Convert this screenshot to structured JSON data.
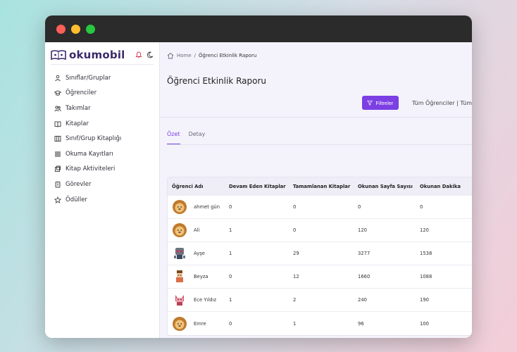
{
  "brand": {
    "name": "okumobil"
  },
  "sidebar": {
    "items": [
      {
        "label": "Sınıflar/Gruplar",
        "icon": "classes-icon"
      },
      {
        "label": "Öğrenciler",
        "icon": "graduation-cap-icon"
      },
      {
        "label": "Takımlar",
        "icon": "users-icon"
      },
      {
        "label": "Kitaplar",
        "icon": "open-book-icon"
      },
      {
        "label": "Sınıf/Grup Kitaplığı",
        "icon": "library-icon"
      },
      {
        "label": "Okuma Kayıtları",
        "icon": "list-icon"
      },
      {
        "label": "Kitap Aktiviteleri",
        "icon": "puzzle-icon"
      },
      {
        "label": "Görevler",
        "icon": "tasks-icon"
      },
      {
        "label": "Ödüller",
        "icon": "star-icon"
      }
    ]
  },
  "breadcrumb": {
    "home": "Home",
    "separator": "/",
    "current": "Öğrenci Etkinlik Raporu"
  },
  "page": {
    "title": "Öğrenci Etkinlik Raporu"
  },
  "toolbar": {
    "filter_label": "Filtreler",
    "scope_text": "Tüm Öğrenciler | Tüm"
  },
  "tabs": [
    {
      "label": "Özet",
      "active": true
    },
    {
      "label": "Detay",
      "active": false
    }
  ],
  "table": {
    "headers": [
      "Öğrenci Adı",
      "Devam Eden Kitaplar",
      "Tamamlanan Kitaplar",
      "Okunan Sayfa Sayısı",
      "Okunan Dakika"
    ],
    "rows": [
      {
        "name": "ahmet gün",
        "avatar": "lion",
        "ongoing": "0",
        "completed": "0",
        "pages": "0",
        "minutes": "0"
      },
      {
        "name": "Ali",
        "avatar": "lion",
        "ongoing": "1",
        "completed": "0",
        "pages": "120",
        "minutes": "120"
      },
      {
        "name": "Ayşe",
        "avatar": "robot",
        "ongoing": "1",
        "completed": "29",
        "pages": "3277",
        "minutes": "1538"
      },
      {
        "name": "Beyza",
        "avatar": "kid",
        "ongoing": "0",
        "completed": "12",
        "pages": "1660",
        "minutes": "1088"
      },
      {
        "name": "Ece Yıldız",
        "avatar": "cat",
        "ongoing": "1",
        "completed": "2",
        "pages": "240",
        "minutes": "190"
      },
      {
        "name": "Emre",
        "avatar": "lion",
        "ongoing": "0",
        "completed": "1",
        "pages": "96",
        "minutes": "100"
      }
    ]
  },
  "colors": {
    "accent": "#7b3fe4",
    "brand": "#3b2a6b"
  }
}
